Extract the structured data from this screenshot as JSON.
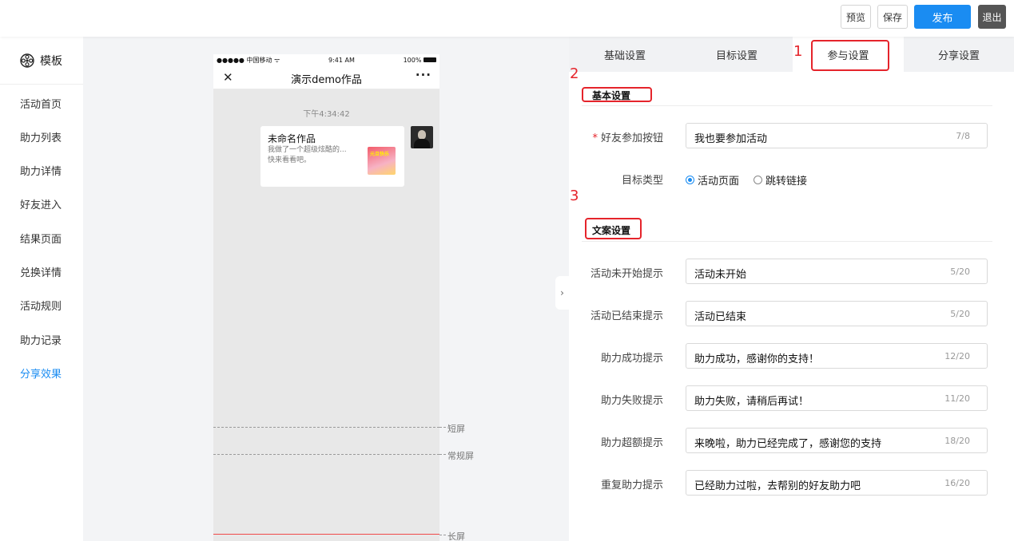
{
  "topbar": {
    "preview_label": "预览",
    "save_label": "保存",
    "publish_label": "发布",
    "exit_label": "退出",
    "publish_color": "#1a8cf2"
  },
  "sidebar": {
    "header_label": "模板",
    "header_icon": "film-reel-icon",
    "active_color": "#1a8cf2",
    "items": [
      {
        "label": "活动首页"
      },
      {
        "label": "助力列表"
      },
      {
        "label": "助力详情"
      },
      {
        "label": "好友进入"
      },
      {
        "label": "结果页面"
      },
      {
        "label": "兑换详情"
      },
      {
        "label": "活动规则"
      },
      {
        "label": "助力记录"
      },
      {
        "label": "分享效果",
        "active": true
      }
    ]
  },
  "phone": {
    "carrier": "●●●●● 中国移动 ᯤ",
    "time": "9:41 AM",
    "battery": "100%",
    "title": "演示demo作品",
    "close_icon": "close-icon",
    "more_icon": "more-dots-icon",
    "message_time": "下午4:34:42",
    "card": {
      "title": "未命名作品",
      "desc_line1": "我做了一个超级炫酷的...",
      "desc_line2": "快来看看吧。",
      "thumb_text": "元旦快乐"
    },
    "guides": {
      "short": "短屏",
      "normal": "常规屏",
      "long": "长屏"
    }
  },
  "panel": {
    "tabs": [
      {
        "label": "基础设置"
      },
      {
        "label": "目标设置"
      },
      {
        "label": "参与设置",
        "active": true
      },
      {
        "label": "分享设置"
      }
    ],
    "annotations": {
      "n1": "1",
      "n2": "2",
      "n3": "3",
      "color": "#e5242b"
    },
    "basic": {
      "title": "基本设置",
      "friend_button_label": "好友参加按钮",
      "friend_button_required": "*",
      "friend_button_value": "我也要参加活动",
      "friend_button_count": "7/8",
      "target_type_label": "目标类型",
      "target_options": [
        {
          "label": "活动页面",
          "selected": true
        },
        {
          "label": "跳转链接",
          "selected": false
        }
      ]
    },
    "copy": {
      "title": "文案设置",
      "fields": [
        {
          "label": "活动未开始提示",
          "value": "活动未开始",
          "count": "5/20"
        },
        {
          "label": "活动已结束提示",
          "value": "活动已结束",
          "count": "5/20"
        },
        {
          "label": "助力成功提示",
          "value": "助力成功，感谢你的支持！",
          "count": "12/20"
        },
        {
          "label": "助力失败提示",
          "value": "助力失败，请稍后再试！",
          "count": "11/20"
        },
        {
          "label": "助力超额提示",
          "value": "来晚啦，助力已经完成了，感谢您的支持",
          "count": "18/20"
        },
        {
          "label": "重复助力提示",
          "value": "已经助力过啦，去帮别的好友助力吧",
          "count": "16/20"
        }
      ]
    }
  }
}
